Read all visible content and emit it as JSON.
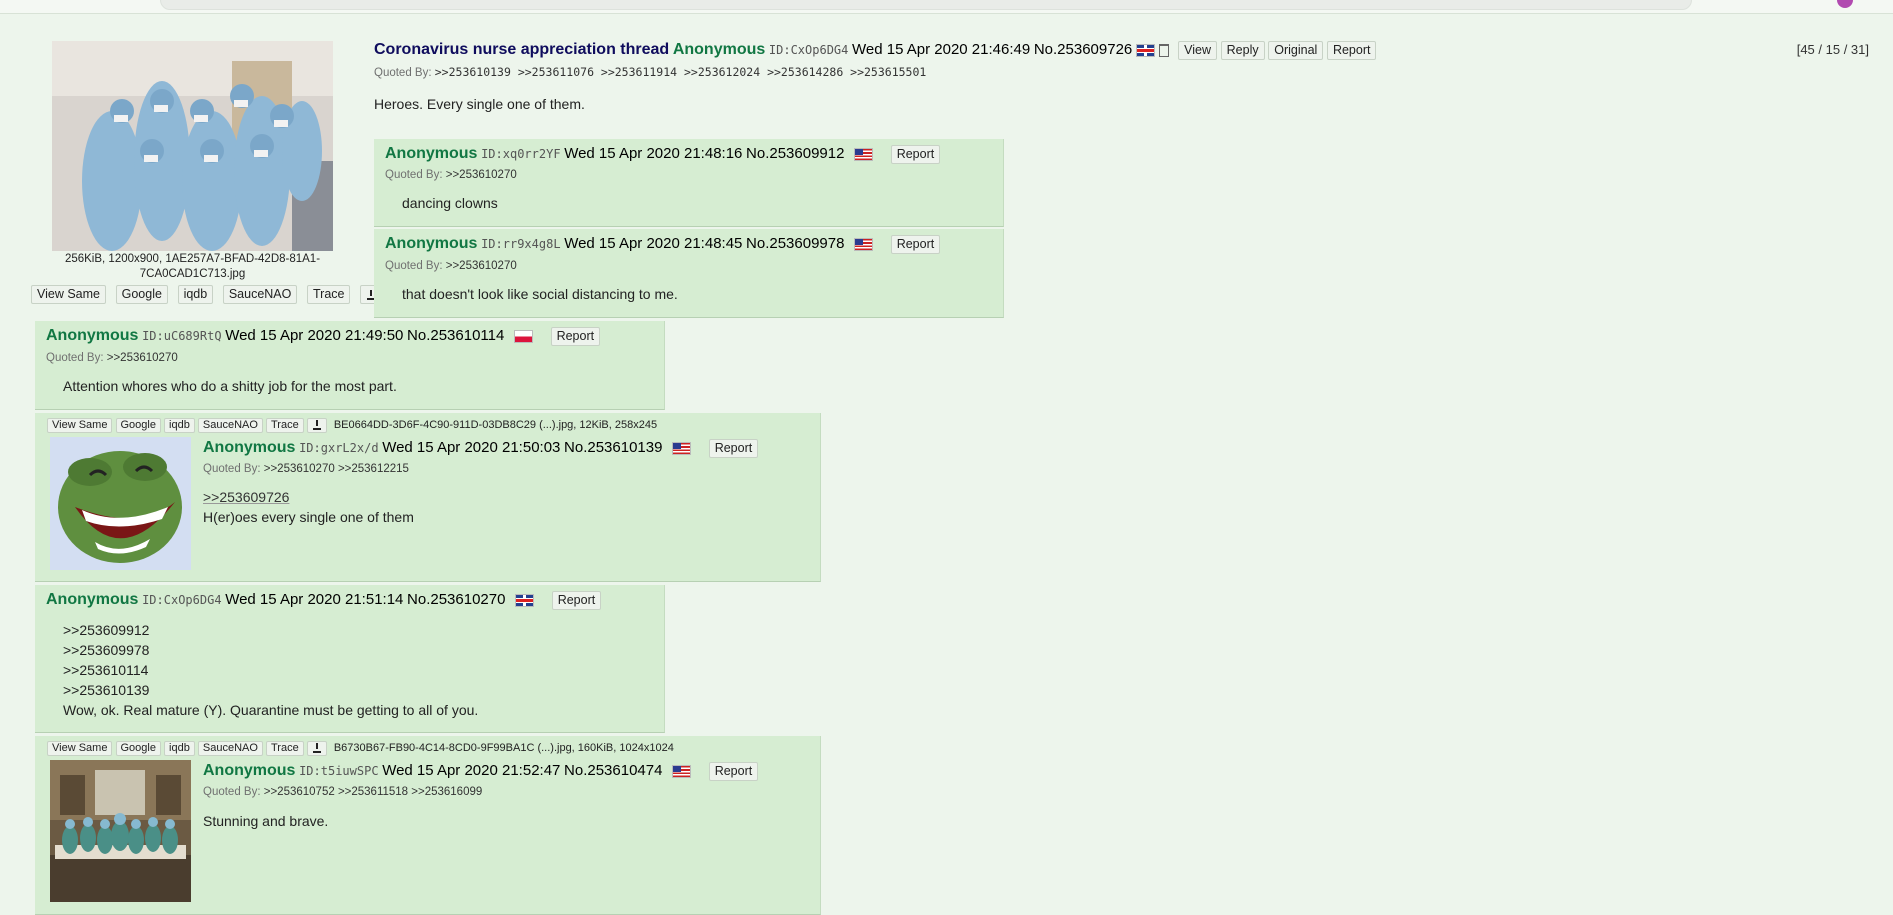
{
  "op": {
    "subject": "Coronavirus nurse appreciation thread",
    "name": "Anonymous",
    "id": "ID:CxOp6DG4",
    "datetime": "Wed 15 Apr 2020 21:46:49",
    "no": "No.253609726",
    "buttons": [
      "View",
      "Reply",
      "Original",
      "Report"
    ],
    "quoted_by_label": "Quoted By:",
    "quoted_by": ">>253610139 >>253611076 >>253611914 >>253612024 >>253614286 >>253615501",
    "message": "Heroes. Every single one of them.",
    "file_info_1": "256KiB, 1200x900, 1AE257A7-BFAD-42D8-81A1-",
    "file_info_2": "7CA0CAD1C713.jpg",
    "image_actions": [
      "View Same",
      "Google",
      "iqdb",
      "SauceNAO",
      "Trace"
    ],
    "counts": "[45 / 15 / 31]",
    "flag": "gb"
  },
  "replies": [
    {
      "name": "Anonymous",
      "id": "ID:xq0rr2YF",
      "datetime": "Wed 15 Apr 2020 21:48:16",
      "no": "No.253609912",
      "report": "Report",
      "quoted_by_label": "Quoted By:",
      "quoted_by": ">>253610270",
      "lines": [
        "dancing clowns"
      ],
      "flag": "us"
    },
    {
      "name": "Anonymous",
      "id": "ID:rr9x4g8L",
      "datetime": "Wed 15 Apr 2020 21:48:45",
      "no": "No.253609978",
      "report": "Report",
      "quoted_by_label": "Quoted By:",
      "quoted_by": ">>253610270",
      "lines": [
        "that doesn't look like social distancing to me."
      ],
      "flag": "us"
    },
    {
      "name": "Anonymous",
      "id": "ID:uC689RtQ",
      "datetime": "Wed 15 Apr 2020 21:49:50",
      "no": "No.253610114",
      "report": "Report",
      "quoted_by_label": "Quoted By:",
      "quoted_by": ">>253610270",
      "lines": [
        "Attention whores who do a shitty job for the most part."
      ],
      "flag": "pl"
    },
    {
      "name": "Anonymous",
      "id": "ID:gxrL2x/d",
      "datetime": "Wed 15 Apr 2020 21:50:03",
      "no": "No.253610139",
      "report": "Report",
      "quoted_by_label": "Quoted By:",
      "quoted_by": ">>253610270 >>253612215",
      "image_actions": [
        "View Same",
        "Google",
        "iqdb",
        "SauceNAO",
        "Trace"
      ],
      "file_info": "BE0664DD-3D6F-4C90-911D-03DB8C29 (...).jpg, 12KiB, 258x245",
      "quote_link": ">>253609726",
      "lines": [
        "H(er)oes every single one of them"
      ],
      "flag": "us"
    },
    {
      "name": "Anonymous",
      "id": "ID:CxOp6DG4",
      "datetime": "Wed 15 Apr 2020 21:51:14",
      "no": "No.253610270",
      "report": "Report",
      "lines": [
        ">>253609912",
        ">>253609978",
        ">>253610114",
        ">>253610139",
        "Wow, ok. Real mature (Y). Quarantine must be getting to all of you."
      ],
      "flag": "gb"
    },
    {
      "name": "Anonymous",
      "id": "ID:t5iuwSPC",
      "datetime": "Wed 15 Apr 2020 21:52:47",
      "no": "No.253610474",
      "report": "Report",
      "quoted_by_label": "Quoted By:",
      "quoted_by": ">>253610752 >>253611518 >>253616099",
      "image_actions": [
        "View Same",
        "Google",
        "iqdb",
        "SauceNAO",
        "Trace"
      ],
      "file_info": "B6730B67-FB90-4C14-8CD0-9F99BA1C (...).jpg, 160KiB, 1024x1024",
      "lines": [
        "Stunning and brave."
      ],
      "flag": "us"
    }
  ]
}
